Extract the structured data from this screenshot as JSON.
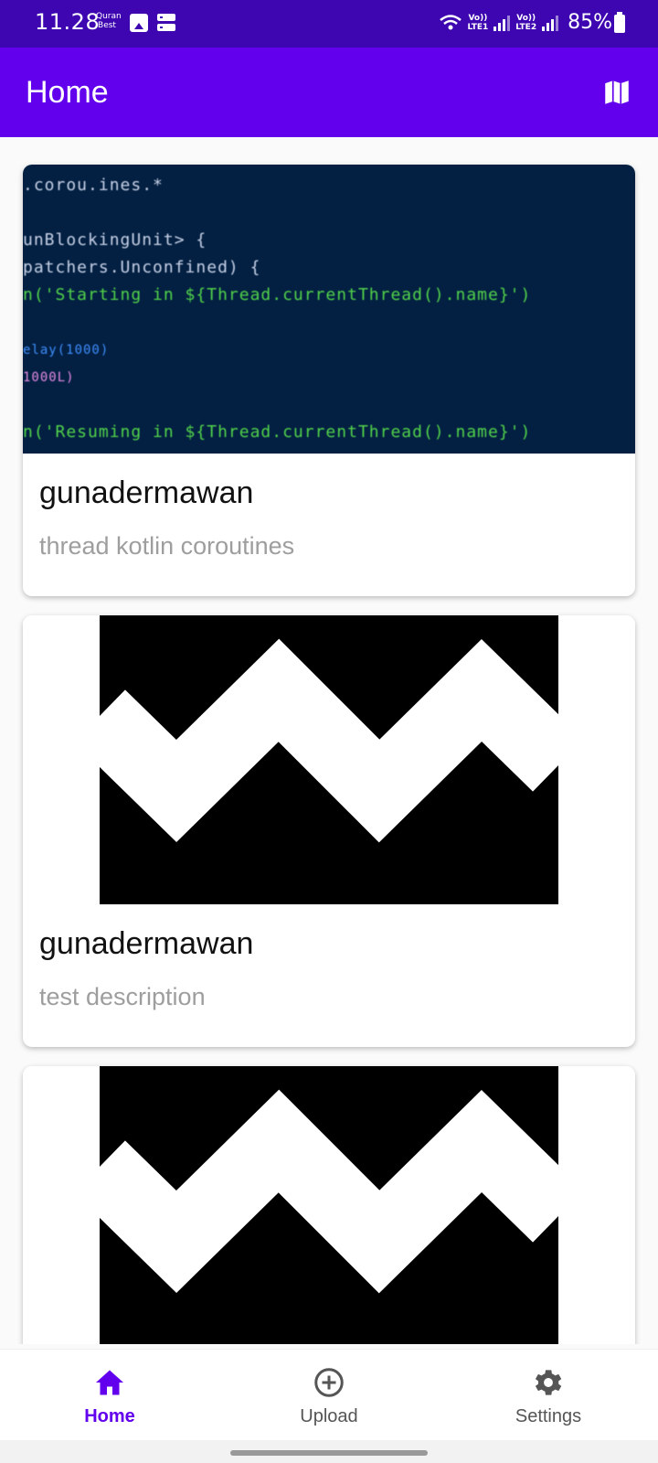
{
  "status_bar": {
    "time": "11.28",
    "quran_line1": "Quran",
    "quran_line2": "Best",
    "lte1_top": "Vo))",
    "lte1_bottom": "LTE1",
    "lte2_top": "Vo))",
    "lte2_bottom": "LTE2",
    "battery": "85%"
  },
  "app_bar": {
    "title": "Home",
    "map_icon": "map-icon"
  },
  "posts": [
    {
      "author": "gunadermawan",
      "description": "thread kotlin coroutines",
      "image": "code-screenshot",
      "code_lines": [
        ".corou.ines.*",
        "",
        "unBlockingUnit> {",
        "patchers.Unconfined) {",
        "n('Starting in ${Thread.currentThread().name}')",
        "",
        "elay(1000)",
        "1000L)",
        "",
        "n('Resuming in ${Thread.currentThread().name}')"
      ]
    },
    {
      "author": "gunadermawan",
      "description": "test description",
      "image": "zigzag-placeholder"
    },
    {
      "author": "",
      "description": "",
      "image": "zigzag-placeholder"
    }
  ],
  "bottom_nav": {
    "items": [
      {
        "label": "Home",
        "icon": "home-icon",
        "active": true
      },
      {
        "label": "Upload",
        "icon": "add-circle-icon",
        "active": false
      },
      {
        "label": "Settings",
        "icon": "gear-icon",
        "active": false
      }
    ]
  },
  "colors": {
    "status_bar": "#3d06b0",
    "app_bar": "#6200ee",
    "active_nav": "#6200ee",
    "code_bg": "#032042"
  }
}
